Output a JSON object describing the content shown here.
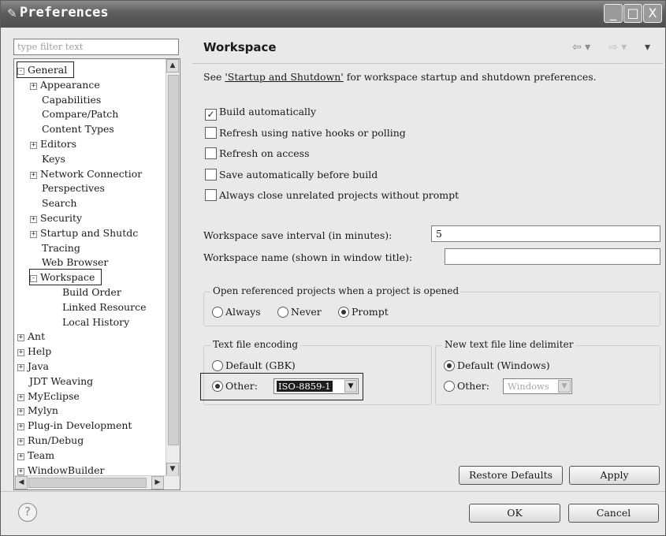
{
  "window": {
    "title": "Preferences",
    "icon": "gear-icon",
    "min": "_",
    "max": "□",
    "close": "X"
  },
  "filter": {
    "placeholder": "type filter text"
  },
  "tree": [
    {
      "label": "General",
      "expander": "-",
      "depth": 0
    },
    {
      "label": "Appearance",
      "expander": "+",
      "depth": 1
    },
    {
      "label": "Capabilities",
      "expander": "",
      "depth": 1
    },
    {
      "label": "Compare/Patch",
      "expander": "",
      "depth": 1
    },
    {
      "label": "Content Types",
      "expander": "",
      "depth": 1
    },
    {
      "label": "Editors",
      "expander": "+",
      "depth": 1
    },
    {
      "label": "Keys",
      "expander": "",
      "depth": 1
    },
    {
      "label": "Network Connectior",
      "expander": "+",
      "depth": 1
    },
    {
      "label": "Perspectives",
      "expander": "",
      "depth": 1
    },
    {
      "label": "Search",
      "expander": "",
      "depth": 1
    },
    {
      "label": "Security",
      "expander": "+",
      "depth": 1
    },
    {
      "label": "Startup and Shutdc",
      "expander": "+",
      "depth": 1
    },
    {
      "label": "Tracing",
      "expander": "",
      "depth": 1
    },
    {
      "label": "Web Browser",
      "expander": "",
      "depth": 1
    },
    {
      "label": "Workspace",
      "expander": "-",
      "depth": 1
    },
    {
      "label": "Build Order",
      "expander": "",
      "depth": 2
    },
    {
      "label": "Linked Resource",
      "expander": "",
      "depth": 2
    },
    {
      "label": "Local History",
      "expander": "",
      "depth": 2
    },
    {
      "label": "Ant",
      "expander": "+",
      "depth": 0
    },
    {
      "label": "Help",
      "expander": "+",
      "depth": 0
    },
    {
      "label": "Java",
      "expander": "+",
      "depth": 0
    },
    {
      "label": "JDT Weaving",
      "expander": "",
      "depth": 0
    },
    {
      "label": "MyEclipse",
      "expander": "+",
      "depth": 0
    },
    {
      "label": "Mylyn",
      "expander": "+",
      "depth": 0
    },
    {
      "label": "Plug-in Development",
      "expander": "+",
      "depth": 0
    },
    {
      "label": "Run/Debug",
      "expander": "+",
      "depth": 0
    },
    {
      "label": "Team",
      "expander": "+",
      "depth": 0
    },
    {
      "label": "WindowBuilder",
      "expander": "+",
      "depth": 0
    }
  ],
  "page": {
    "title": "Workspace",
    "nav_back": "⇦ ▾",
    "nav_forward": "⇨ ▾",
    "menu": "▾",
    "desc_prefix": "See ",
    "desc_link": "'Startup and Shutdown'",
    "desc_suffix": " for workspace startup and shutdown preferences.",
    "checkboxes": [
      {
        "label": "Build automatically",
        "checked": true
      },
      {
        "label": "Refresh using native hooks or polling",
        "checked": false
      },
      {
        "label": "Refresh on access",
        "checked": false
      },
      {
        "label": "Save automatically before build",
        "checked": false
      },
      {
        "label": "Always close unrelated projects without prompt",
        "checked": false
      }
    ],
    "save_interval_label": "Workspace save interval (in minutes):",
    "save_interval_value": "5",
    "workspace_name_label": "Workspace name (shown in window title):",
    "workspace_name_value": "",
    "open_ref_group": "Open referenced projects when a project is opened",
    "open_ref_options": [
      "Always",
      "Never",
      "Prompt"
    ],
    "open_ref_selected": "Prompt",
    "encoding_group": "Text file encoding",
    "encoding_default": "Default (GBK)",
    "encoding_other": "Other:",
    "encoding_value": "ISO-8859-1",
    "delimiter_group": "New text file line delimiter",
    "delimiter_default": "Default (Windows)",
    "delimiter_other": "Other:",
    "delimiter_value": "Windows",
    "restore_defaults": "Restore Defaults",
    "apply": "Apply"
  },
  "footer": {
    "help": "?",
    "ok": "OK",
    "cancel": "Cancel"
  }
}
